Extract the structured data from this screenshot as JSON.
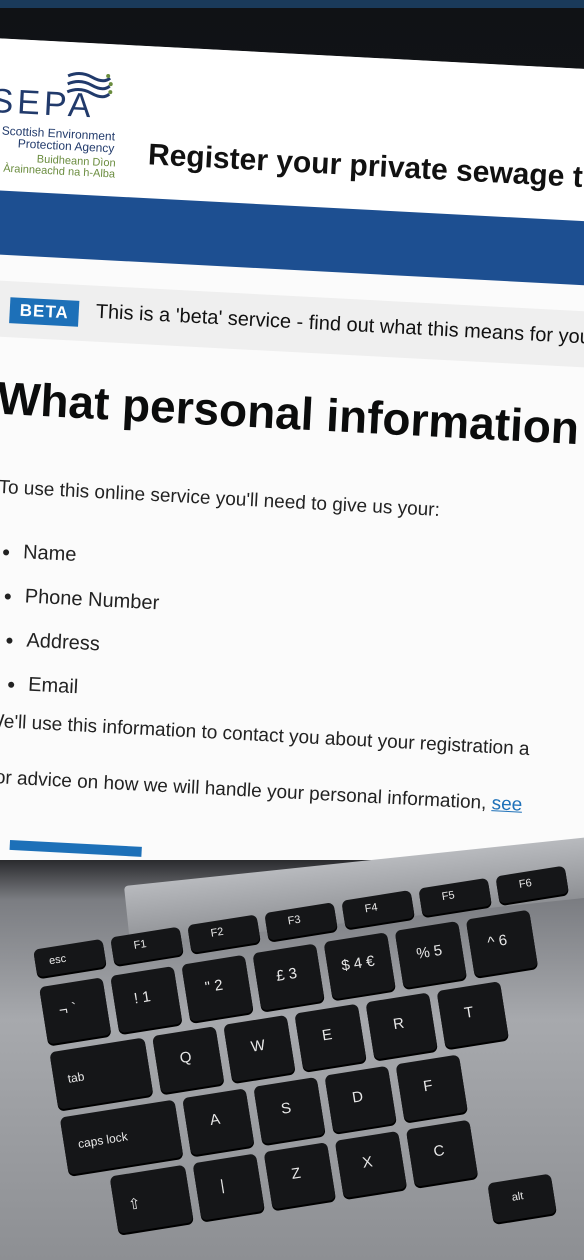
{
  "header": {
    "logo_text": "SEPA",
    "org_name_line1": "Scottish Environment",
    "org_name_line2": "Protection Agency",
    "org_gaelic_line1": "Buidheann Dìon",
    "org_gaelic_line2": "Àrainneachd na h-Alba",
    "service_title": "Register your private sewage tre"
  },
  "phase_banner": {
    "tag": "BETA",
    "text": "This is a 'beta' service - find out what this means for you"
  },
  "main": {
    "heading": "What personal information w",
    "intro": "To use this online service you'll need to give us your:",
    "items": [
      "Name",
      "Phone Number",
      "Address",
      "Email"
    ],
    "para1": "We'll use this information to contact you about your registration a",
    "para2_text": "For advice on how we will handle your personal information,",
    "para2_link": "see"
  },
  "keyboard": {
    "row1": [
      "esc",
      "F1",
      "F2",
      "F3",
      "F4",
      "F5",
      "F6"
    ],
    "row2": [
      "¬ `",
      "! 1",
      "\" 2",
      "£ 3",
      "$ 4 €",
      "% 5",
      "^ 6"
    ],
    "row3": [
      "tab",
      "Q",
      "W",
      "E",
      "R",
      "T"
    ],
    "row4": [
      "caps lock",
      "A",
      "S",
      "D",
      "F"
    ],
    "row5": [
      "⇧",
      "|",
      "Z",
      "X",
      "C"
    ],
    "alt": "alt"
  },
  "colors": {
    "brand_blue": "#1d4f91",
    "beta_blue": "#1d70b8",
    "phase_bg": "#efefef",
    "text": "#0b0c0c"
  }
}
